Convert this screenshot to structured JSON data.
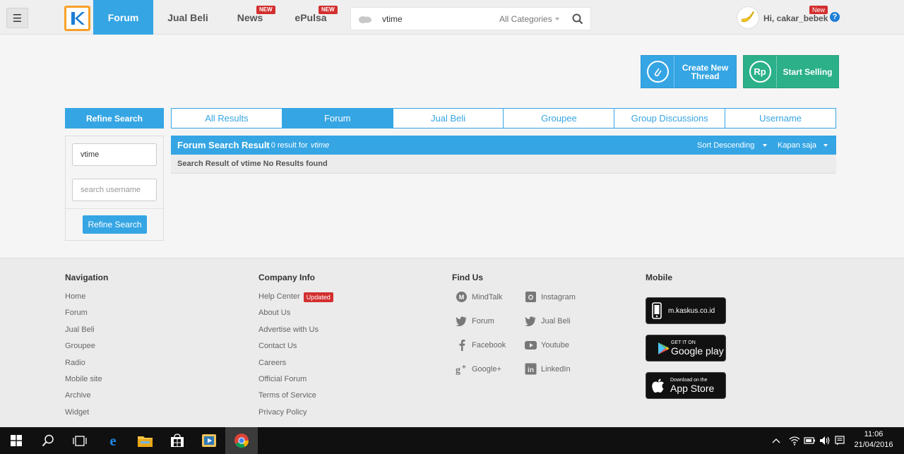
{
  "header": {
    "menu_icon": "hamburger-icon",
    "logo": "kaskus-logo",
    "nav": [
      {
        "label": "Forum",
        "active": true
      },
      {
        "label": "Jual Beli"
      },
      {
        "label": "News",
        "badge": "NEW"
      },
      {
        "label": "ePulsa",
        "badge": "NEW"
      }
    ],
    "search": {
      "value": "vtime",
      "category": "All Categories"
    },
    "user": {
      "greeting": "Hi, cakar_bebek",
      "badge": "New"
    }
  },
  "actions": {
    "create_thread": "Create New Thread",
    "start_selling": "Start Selling",
    "sell_icon_text": "Rp"
  },
  "sidebar": {
    "title": "Refine Search",
    "keyword_value": "vtime",
    "username_placeholder": "search username",
    "button_label": "Refine Search"
  },
  "tabs": [
    {
      "label": "All Results"
    },
    {
      "label": "Forum",
      "active": true
    },
    {
      "label": "Jual Beli"
    },
    {
      "label": "Groupee"
    },
    {
      "label": "Group Discussions"
    },
    {
      "label": "Username"
    }
  ],
  "results": {
    "title": "Forum Search Result",
    "count_text": " - 0 result for ",
    "query": "vtime",
    "sort": "Sort Descending",
    "time": "Kapan saja",
    "empty_message": "Search Result of vtime No Results found"
  },
  "footer": {
    "navigation": {
      "title": "Navigation",
      "links": [
        "Home",
        "Forum",
        "Jual Beli",
        "Groupee",
        "Radio",
        "Mobile site",
        "Archive",
        "Widget"
      ]
    },
    "company": {
      "title": "Company Info",
      "links": [
        "Help Center",
        "About Us",
        "Advertise with Us",
        "Contact Us",
        "Careers",
        "Official Forum",
        "Terms of Service",
        "Privacy Policy"
      ],
      "help_badge": "Updated"
    },
    "find_us": {
      "title": "Find Us",
      "items": [
        {
          "label": "MindTalk",
          "icon": "mindtalk-icon"
        },
        {
          "label": "Instagram",
          "icon": "instagram-icon"
        },
        {
          "label": "Forum",
          "icon": "twitter-icon"
        },
        {
          "label": "Jual Beli",
          "icon": "twitter-icon"
        },
        {
          "label": "Facebook",
          "icon": "facebook-icon"
        },
        {
          "label": "Youtube",
          "icon": "youtube-icon"
        },
        {
          "label": "Google+",
          "icon": "googleplus-icon"
        },
        {
          "label": "LinkedIn",
          "icon": "linkedin-icon"
        }
      ]
    },
    "mobile": {
      "title": "Mobile",
      "mobile_site": "m.kaskus.co.id",
      "google_small": "GET IT ON",
      "google_big": "Google play",
      "apple_small": "Download on the",
      "apple_big": "App Store"
    }
  },
  "taskbar": {
    "time": "11:06",
    "date": "21/04/2016"
  },
  "colors": {
    "primary": "#35a5e4",
    "sell": "#2bb08a",
    "badge": "#d32f2f"
  }
}
